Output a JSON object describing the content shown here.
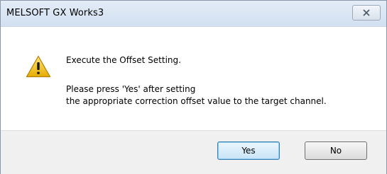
{
  "window": {
    "title": "MELSOFT GX Works3"
  },
  "icons": {
    "warning": "warning-icon",
    "close": "close-icon"
  },
  "message": {
    "line1": "Execute the Offset Setting.",
    "line2": "Please press 'Yes' after setting",
    "line3": "the appropriate correction offset value to the target channel."
  },
  "buttons": {
    "yes_label": "Yes",
    "no_label": "No"
  },
  "colors": {
    "warning_yellow": "#f2c200",
    "focus_blue": "#3c7fb1"
  }
}
